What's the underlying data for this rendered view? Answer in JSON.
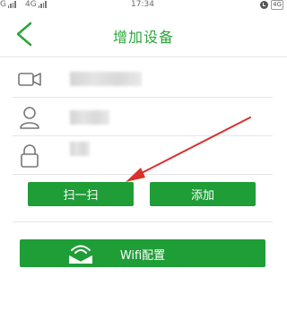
{
  "status_bar": {
    "left_carrier_1": "G",
    "left_carrier_2": "4G",
    "time": "17:34",
    "right_badge": "4G"
  },
  "header": {
    "title": "增加设备"
  },
  "form": {
    "device_field": {
      "value": "",
      "placeholder": ""
    },
    "username_field": {
      "value": "",
      "placeholder": ""
    },
    "password_field": {
      "value": "",
      "placeholder": ""
    }
  },
  "actions": {
    "scan_label": "扫一扫",
    "add_label": "添加",
    "wifi_label": "Wifi配置"
  },
  "colors": {
    "accent": "#1f9d37",
    "title": "#2aa63a",
    "annotation_arrow": "#d9312b"
  },
  "icons": {
    "back": "back-chevron-icon",
    "device": "camera-icon",
    "user": "user-icon",
    "lock": "lock-icon",
    "wifi": "wifi-envelope-icon"
  }
}
